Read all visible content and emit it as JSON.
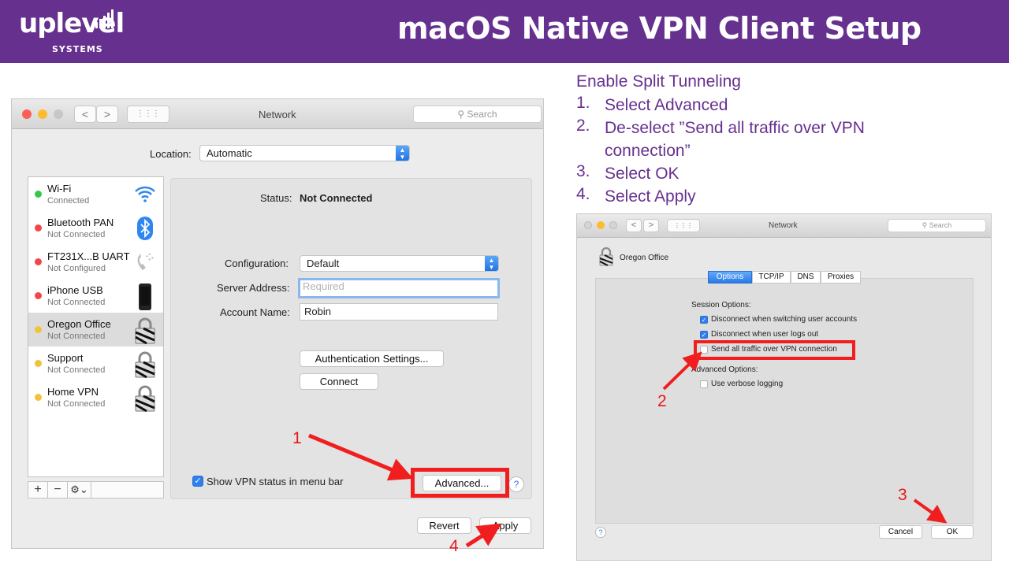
{
  "banner": {
    "logo_word": "uplevel",
    "logo_sub": "SYSTEMS",
    "title": "macOS Native VPN Client Setup"
  },
  "left_window": {
    "title": "Network",
    "search_placeholder": "Search",
    "nav_back": "<",
    "nav_forward": ">",
    "grid_glyph": "⋮⋮⋮",
    "location_label": "Location:",
    "location_value": "Automatic",
    "services": [
      {
        "name": "Wi-Fi",
        "status": "Connected",
        "dot": "#34c84a",
        "icon": "wifi-icon"
      },
      {
        "name": "Bluetooth PAN",
        "status": "Not Connected",
        "dot": "#f04848",
        "icon": "bluetooth-icon"
      },
      {
        "name": "FT231X...B UART",
        "status": "Not Configured",
        "dot": "#f04848",
        "icon": "phone-handset-icon"
      },
      {
        "name": "iPhone USB",
        "status": "Not Connected",
        "dot": "#f04848",
        "icon": "iphone-icon"
      },
      {
        "name": "Oregon Office",
        "status": "Not Connected",
        "dot": "#f3c13a",
        "icon": "vpn-lock-icon"
      },
      {
        "name": "Support",
        "status": "Not Connected",
        "dot": "#f3c13a",
        "icon": "vpn-lock-icon"
      },
      {
        "name": "Home VPN",
        "status": "Not Connected",
        "dot": "#f3c13a",
        "icon": "vpn-lock-icon"
      }
    ],
    "add_glyph": "+",
    "remove_glyph": "−",
    "gear_glyph": "⚙⌄",
    "status_label": "Status:",
    "status_value": "Not Connected",
    "configuration_label": "Configuration:",
    "configuration_value": "Default",
    "server_label": "Server Address:",
    "server_placeholder": "Required",
    "account_label": "Account Name:",
    "account_value": "Robin",
    "auth_button": "Authentication Settings...",
    "connect_button": "Connect",
    "show_vpn_status": "Show VPN status in menu bar",
    "advanced_button": "Advanced...",
    "help_glyph": "?",
    "revert_button": "Revert",
    "apply_button": "Apply"
  },
  "annotations": {
    "step1": "1",
    "step2": "2",
    "step3": "3",
    "step4": "4",
    "red": "#f01e1e"
  },
  "instructions": {
    "heading": "Enable Split Tunneling",
    "steps": [
      {
        "num": "1.",
        "text": "Select Advanced"
      },
      {
        "num": "2.",
        "text": "De-select ”Send all traffic over VPN connection”"
      },
      {
        "num": "3.",
        "text": "Select OK"
      },
      {
        "num": "4.",
        "text": "Select Apply"
      }
    ],
    "color": "#66308f"
  },
  "right_window": {
    "title": "Network",
    "search_placeholder": "Search",
    "service_name": "Oregon Office",
    "tabs": [
      "Options",
      "TCP/IP",
      "DNS",
      "Proxies"
    ],
    "active_tab": "Options",
    "session_options_label": "Session Options:",
    "session_options": [
      {
        "label": "Disconnect when switching user accounts",
        "checked": true
      },
      {
        "label": "Disconnect when user logs out",
        "checked": true
      },
      {
        "label": "Send all traffic over VPN connection",
        "checked": false
      }
    ],
    "advanced_options_label": "Advanced Options:",
    "verbose_logging": "Use verbose logging",
    "help_glyph": "?",
    "cancel_button": "Cancel",
    "ok_button": "OK"
  }
}
